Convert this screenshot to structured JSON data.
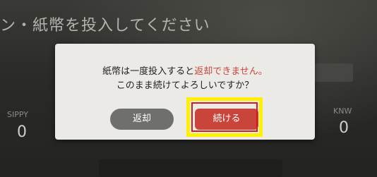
{
  "background": {
    "heading": "ン・紙幣を投入してください",
    "left_label": "SIPPY",
    "left_value": "0",
    "right_label": "KNW",
    "right_value": "0"
  },
  "dialog": {
    "line1_prefix": "紙幣は一度投入すると",
    "line1_accent": "返却できません。",
    "line2": "このまま続けてよろしいですか？",
    "return_label": "返却",
    "continue_label": "続ける"
  },
  "colors": {
    "accent": "#c9443b",
    "highlight_yellow": "#ffef00",
    "highlight_red": "#d21d1d",
    "return_button": "#6f6f6c",
    "dialog_bg": "#eceae6"
  }
}
